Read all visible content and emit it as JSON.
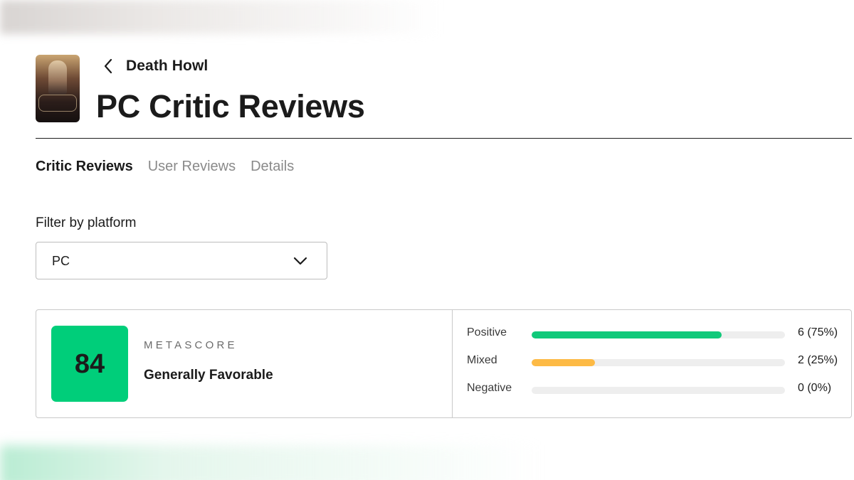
{
  "header": {
    "game_name": "Death Howl",
    "page_title": "PC Critic Reviews"
  },
  "tabs": [
    {
      "label": "Critic Reviews",
      "active": true
    },
    {
      "label": "User Reviews",
      "active": false
    },
    {
      "label": "Details",
      "active": false
    }
  ],
  "filter": {
    "label": "Filter by platform",
    "selected": "PC"
  },
  "metascore": {
    "label": "METASCORE",
    "score": "84",
    "description": "Generally Favorable",
    "color": "#00ce7a"
  },
  "distribution": [
    {
      "label": "Positive",
      "count_text": "6 (75%)",
      "fraction": 0.75,
      "color": "#10c97a"
    },
    {
      "label": "Mixed",
      "count_text": "2 (25%)",
      "fraction": 0.25,
      "color": "#fdba45"
    },
    {
      "label": "Negative",
      "count_text": "0 (0%)",
      "fraction": 0.0,
      "color": "#e5484d"
    }
  ],
  "icons": {
    "back": "chevron-left-icon",
    "dropdown": "chevron-down-icon"
  }
}
